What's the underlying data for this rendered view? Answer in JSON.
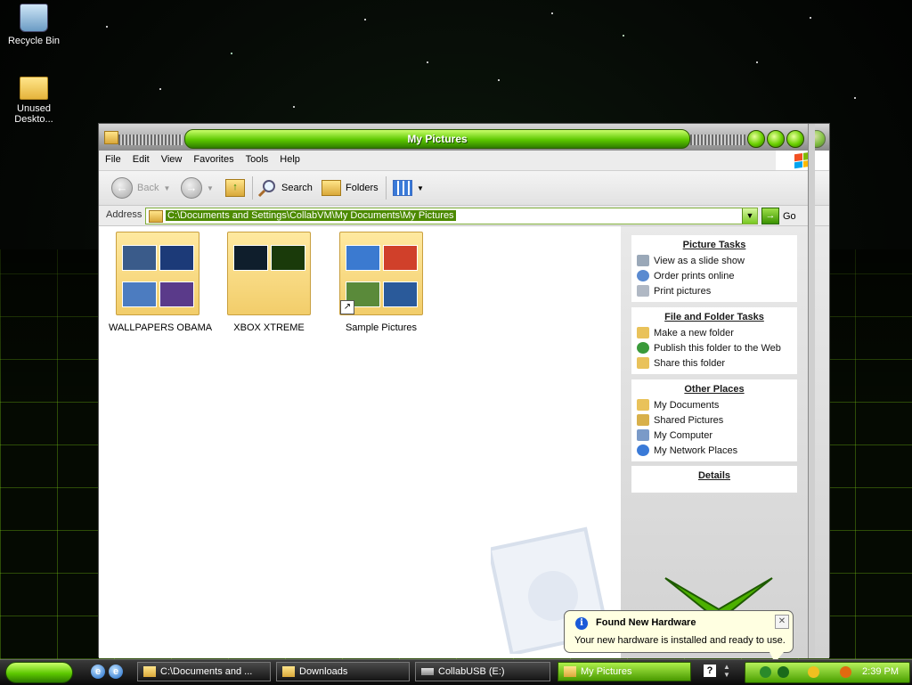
{
  "desktop": {
    "icons": [
      {
        "label": "Recycle Bin"
      },
      {
        "label": "Unused Deskto..."
      }
    ]
  },
  "window": {
    "title": "My Pictures",
    "menu": [
      "File",
      "Edit",
      "View",
      "Favorites",
      "Tools",
      "Help"
    ],
    "toolbar": {
      "back_label": "Back",
      "search_label": "Search",
      "folders_label": "Folders"
    },
    "address": {
      "label": "Address",
      "value": "C:\\Documents and Settings\\CollabVM\\My Documents\\My Pictures",
      "go_label": "Go"
    },
    "folders": [
      {
        "name": "WALLPAPERS OBAMA",
        "thumbs": [
          "#3a5b8a",
          "#1c3a78",
          "#4c7cc0",
          "#5a3a8a"
        ]
      },
      {
        "name": "XBOX XTREME",
        "thumbs": [
          "#0f1e2c",
          "#1a3a0a"
        ]
      },
      {
        "name": "Sample Pictures",
        "thumbs": [
          "#3b7ad0",
          "#d0402a",
          "#5a8a3a",
          "#2a5a9a"
        ]
      }
    ],
    "task_pane": {
      "picture_tasks": {
        "title": "Picture Tasks",
        "items": [
          "View as a slide show",
          "Order prints online",
          "Print pictures"
        ]
      },
      "file_folder_tasks": {
        "title": "File and Folder Tasks",
        "items": [
          "Make a new folder",
          "Publish this folder to the Web",
          "Share this folder"
        ]
      },
      "other_places": {
        "title": "Other Places",
        "items": [
          "My Documents",
          "Shared Pictures",
          "My Computer",
          "My Network Places"
        ]
      },
      "details": {
        "title": "Details"
      }
    }
  },
  "balloon": {
    "title": "Found New Hardware",
    "text": "Your new hardware is installed and ready to use."
  },
  "taskbar": {
    "tasks": [
      {
        "label": "C:\\Documents and ..."
      },
      {
        "label": "Downloads"
      },
      {
        "label": "CollabUSB (E:)"
      },
      {
        "label": "My Pictures"
      }
    ],
    "clock": "2:39 PM"
  },
  "colors": {
    "accent": "#5cc800",
    "selection": "#4c8a00"
  }
}
